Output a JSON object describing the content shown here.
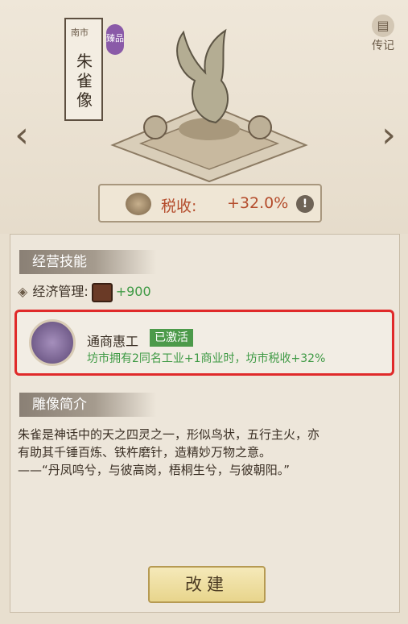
{
  "header": {
    "region_tag": "南市",
    "statue_name": "朱雀像",
    "quality_badge": "臻品",
    "biography_label": "传记"
  },
  "tax": {
    "label": "税收:",
    "value": "+32.0%"
  },
  "business_skill": {
    "title": "经营技能",
    "skill_name": "经济管理:",
    "skill_value": "+900"
  },
  "ability": {
    "name": "通商惠工",
    "status": "已激活",
    "description": "坊市拥有2同名工业+1商业时，坊市税收+32%"
  },
  "intro": {
    "title": "雕像简介",
    "lines": [
      "朱雀是神话中的天之四灵之一，形似鸟状，五行主火，亦",
      "有助其千锤百炼、铁杵磨针，造精妙万物之意。",
      "——“丹凤鸣兮，与彼高岗，梧桐生兮，与彼朝阳。”"
    ]
  },
  "actions": {
    "rebuild_label": "改建"
  },
  "colors": {
    "tax_text": "#b44c2c",
    "positive": "#3f9a45",
    "activated_tag": "#4c9a4a",
    "highlight_border": "#e02a2a",
    "button_fill": "#f0e2a6"
  },
  "icons": {
    "coin": "coin-pile-icon",
    "info": "exclamation-info-icon",
    "skill": "ledger-book-icon",
    "ability": "scroll-documents-icon",
    "biography": "scroll-book-icon",
    "nav_left": "chevron-left-icon",
    "nav_right": "chevron-right-icon"
  }
}
